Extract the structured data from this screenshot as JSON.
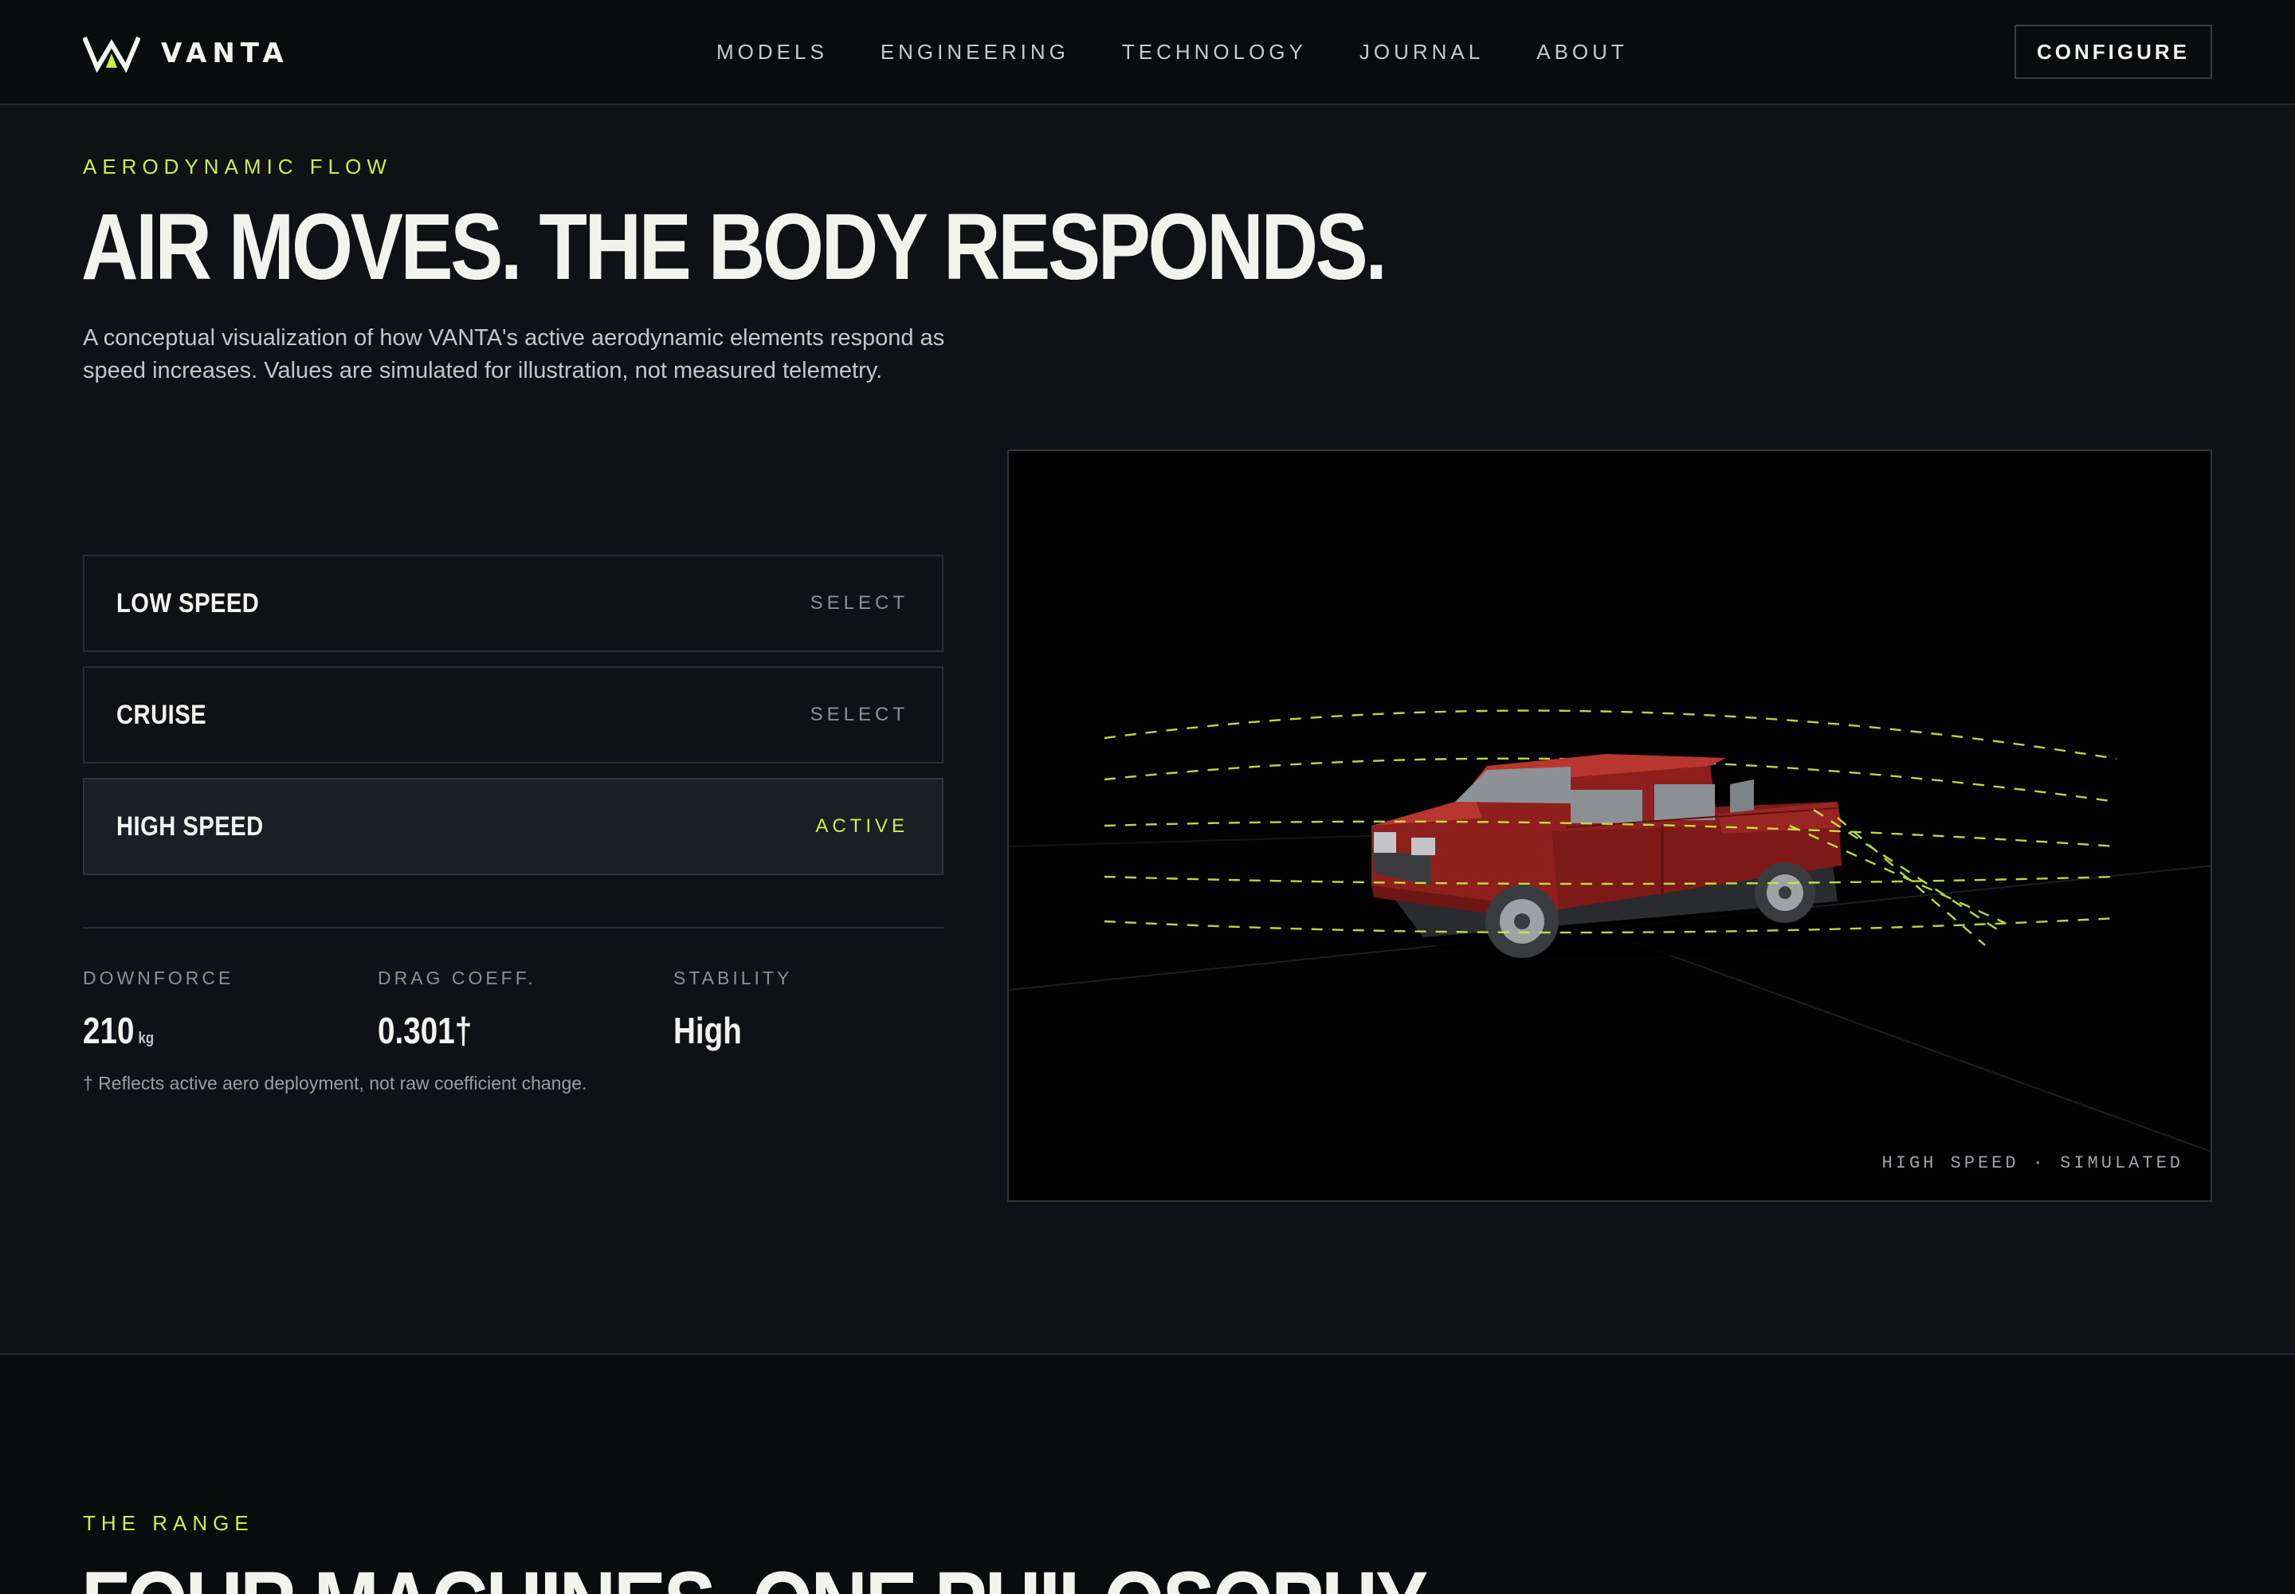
{
  "nav": {
    "brand": "VANTA",
    "links": [
      "MODELS",
      "ENGINEERING",
      "TECHNOLOGY",
      "JOURNAL",
      "ABOUT"
    ],
    "cta": "CONFIGURE"
  },
  "hero": {
    "eyebrow": "AERODYNAMIC FLOW",
    "title": "AIR MOVES. THE BODY RESPONDS.",
    "description": "A conceptual visualization of how VANTA's active aerodynamic elements respond as speed increases. Values are simulated for illustration, not measured telemetry."
  },
  "modes": [
    {
      "label": "LOW SPEED",
      "action": "SELECT",
      "active": false
    },
    {
      "label": "CRUISE",
      "action": "SELECT",
      "active": false
    },
    {
      "label": "HIGH SPEED",
      "action": "ACTIVE",
      "active": true
    }
  ],
  "stats": [
    {
      "label": "DOWNFORCE",
      "value": "210",
      "unit": "kg"
    },
    {
      "label": "DRAG COEFF.",
      "value": "0.301†",
      "unit": ""
    },
    {
      "label": "STABILITY",
      "value": "High",
      "unit": ""
    }
  ],
  "footnote": "† Reflects active aero deployment, not raw coefficient change.",
  "viewer": {
    "caption": "HIGH SPEED · SIMULATED",
    "flow_color": "#c9f23f",
    "car_color": "#8f1f1d"
  },
  "range": {
    "eyebrow": "THE RANGE",
    "title": "FOUR MACHINES. ONE PHILOSOPHY."
  },
  "colors": {
    "accent": "#c9f23f",
    "background": "#0f1115",
    "nav_background": "#0a0b0d"
  }
}
